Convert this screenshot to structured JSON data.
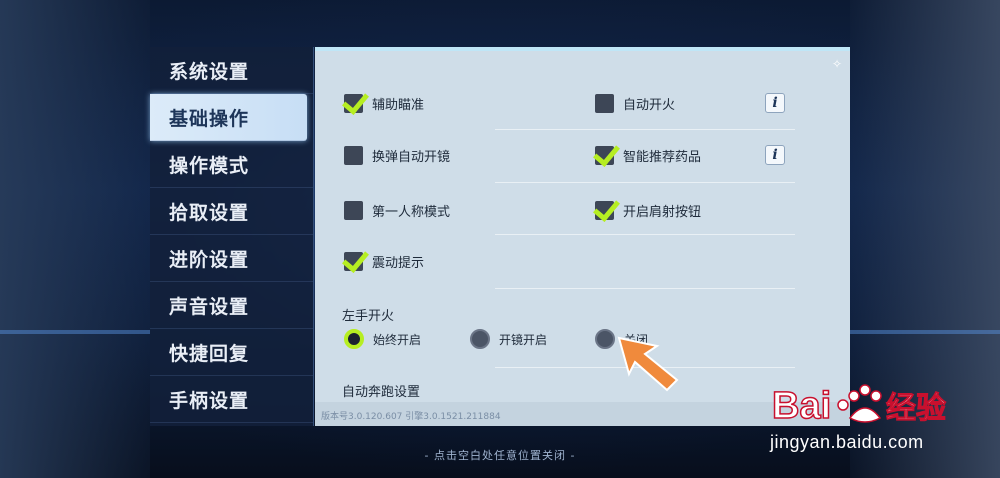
{
  "sidebar": {
    "items": [
      {
        "label": "系统设置",
        "active": false
      },
      {
        "label": "基础操作",
        "active": true
      },
      {
        "label": "操作模式",
        "active": false
      },
      {
        "label": "拾取设置",
        "active": false
      },
      {
        "label": "进阶设置",
        "active": false
      },
      {
        "label": "声音设置",
        "active": false
      },
      {
        "label": "快捷回复",
        "active": false
      },
      {
        "label": "手柄设置",
        "active": false
      }
    ]
  },
  "options": {
    "aim_assist": {
      "label": "辅助瞄准",
      "checked": true
    },
    "auto_fire": {
      "label": "自动开火",
      "checked": false
    },
    "reload_auto_scope": {
      "label": "换弹自动开镜",
      "checked": false
    },
    "smart_meds": {
      "label": "智能推荐药品",
      "checked": true
    },
    "first_person": {
      "label": "第一人称模式",
      "checked": false
    },
    "shoulder_fire": {
      "label": "开启肩射按钮",
      "checked": true
    },
    "vibration": {
      "label": "震动提示",
      "checked": true
    }
  },
  "info_icon": "i",
  "left_fire": {
    "title": "左手开火",
    "options": [
      {
        "label": "始终开启",
        "selected": true
      },
      {
        "label": "开镜开启",
        "selected": false
      },
      {
        "label": "关闭",
        "selected": false
      }
    ]
  },
  "auto_run": {
    "title": "自动奔跑设置"
  },
  "version_text": "版本号3.0.120.607   引擎3.0.1521.211884",
  "footer_hint": "- 点击空白处任意位置关闭 -",
  "watermark": {
    "brand": "Bai du 经验",
    "url": "jingyan.baidu.com"
  },
  "colors": {
    "check": "#b6ee22",
    "arrow": "#f08a3c",
    "active_tab": "#dcebf9"
  },
  "icons": {
    "checkbox": "checkbox-icon",
    "info": "info-icon",
    "radio": "radio-icon",
    "arrow": "pointer-arrow-icon"
  }
}
